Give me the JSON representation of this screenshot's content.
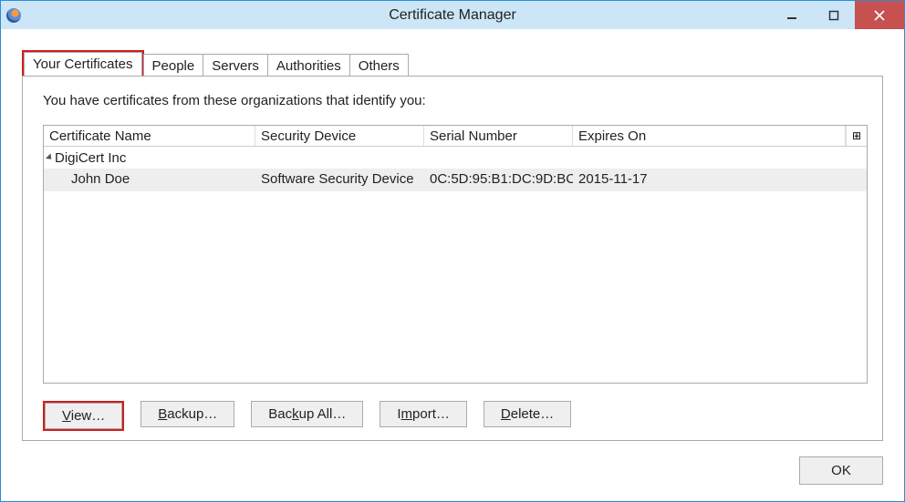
{
  "window": {
    "title": "Certificate Manager"
  },
  "tabs": {
    "your_certs": "Your Certificates",
    "people": "People",
    "servers": "Servers",
    "authorities": "Authorities",
    "others": "Others"
  },
  "intro": "You have certificates from these organizations that identify you:",
  "columns": {
    "name": "Certificate Name",
    "device": "Security Device",
    "serial": "Serial Number",
    "expires": "Expires On"
  },
  "group": {
    "label": "DigiCert Inc"
  },
  "rows": [
    {
      "name": "John  Doe",
      "device": "Software Security Device",
      "serial": "0C:5D:95:B1:DC:9D:BC:...",
      "expires": "2015-11-17"
    }
  ],
  "actions": {
    "view": "View…",
    "backup": "Backup…",
    "backup_all": "Backup All…",
    "import": "Import…",
    "delete": "Delete…"
  },
  "footer": {
    "ok": "OK"
  },
  "column_picker_glyph": "⊞"
}
